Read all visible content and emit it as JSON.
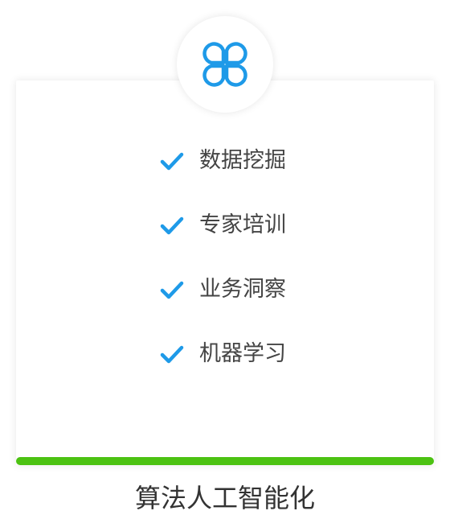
{
  "badge": {
    "icon": "clover-icon",
    "color": "#1e9ae8"
  },
  "features": [
    {
      "icon": "check-icon",
      "label": "数据挖掘"
    },
    {
      "icon": "check-icon",
      "label": "专家培训"
    },
    {
      "icon": "check-icon",
      "label": "业务洞察"
    },
    {
      "icon": "check-icon",
      "label": "机器学习"
    }
  ],
  "colors": {
    "check": "#1e9ae8",
    "accent_bar": "#4cc212",
    "label_text": "#444444"
  },
  "caption": "算法人工智能化"
}
